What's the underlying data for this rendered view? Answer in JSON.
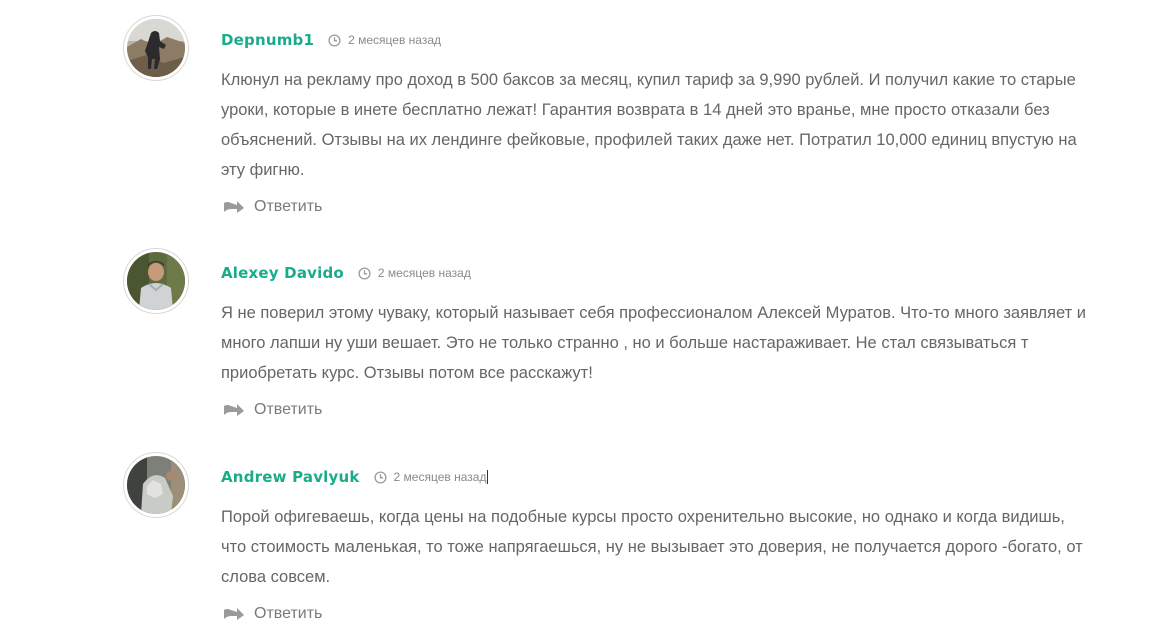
{
  "comments": [
    {
      "author": "Depnumb1",
      "date": "2 месяцев назад",
      "text": "Клюнул на рекламу про доход в 500 баксов за месяц, купил тариф за 9,990 рублей. И получил какие то старые уроки, которые в инете бесплатно лежат! Гарантия возврата в 14 дней это вранье, мне просто отказали без объяснений. Отзывы на их лендинге фейковые, профилей таких даже нет. Потратил 10,000 единиц впустую на эту фигню.",
      "reply_label": "Ответить"
    },
    {
      "author": "Alexey Davido",
      "date": "2 месяцев назад",
      "text": "Я не поверил этому чуваку, который называет себя профессионалом Алексей Муратов. Что-то много заявляет и много лапши ну уши вешает. Это не только странно , но и больше настараживает. Не стал связываться т приобретать курс. Отзывы потом все расскажут!",
      "reply_label": "Ответить"
    },
    {
      "author": "Andrew Pavlyuk",
      "date": "2 месяцев назад",
      "text": "Порой офигеваешь, когда цены на подобные курсы просто охренительно высокие, но однако и когда видишь, что стоимость маленькая, то тоже напрягаешься, ну не вызывает это доверия, не получается дорого -богато, от слова совсем.",
      "reply_label": "Ответить"
    }
  ],
  "colors": {
    "author": "#1aab8a",
    "text": "#666666",
    "meta": "#8a8a8a"
  },
  "icons": {
    "date": "clock-icon",
    "reply": "reply-arrow-icon"
  }
}
